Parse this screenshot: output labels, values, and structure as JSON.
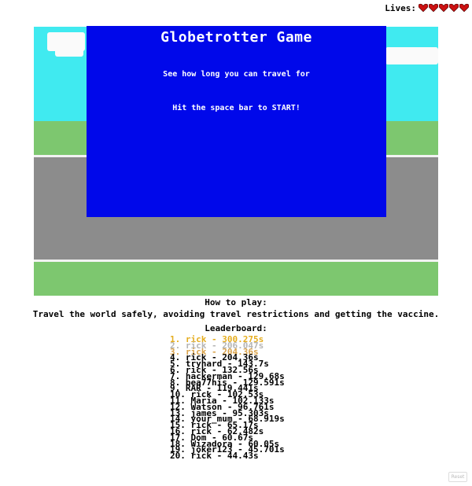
{
  "hud": {
    "lives_label": "Lives:",
    "lives_count": 5
  },
  "menu": {
    "title": "Globetrotter Game",
    "subtitle": "See how long you can travel for",
    "start": "Hit the space bar to START!"
  },
  "howto": {
    "title": "How to play:",
    "text": "Travel the world safely, avoiding travel restrictions and getting the vaccine."
  },
  "leaderboard": {
    "title": "Leaderboard:",
    "entries": [
      "1. rick - 300.275s",
      "2. rick - 206.047s",
      "3. rick - 204.36s",
      "4. rick - 204.36s",
      "5. tryhard - 143.7s",
      "6. rick - 132.56s",
      "7. hackerman - 129.68s",
      "8. bea77his - 129.591s",
      "9. RAR - 119.441s",
      "10. rick - 102.53s",
      "11. Maria - 102.133s",
      "12. Watson - 96.761s",
      "13. james - 95.303s",
      "14. your_mum - 68.919s",
      "15. rick - 65.17s",
      "16. rick - 62.482s",
      "17. Dom - 60.67s",
      "18. Wizadora - 60.05s",
      "19. joker123 - 45.701s",
      "20. rick - 44.43s"
    ]
  },
  "reset_label": "Reset",
  "colors": {
    "gold": "#e5ad1f",
    "silver": "#b5b5b5",
    "bronze": "#d9a24a",
    "menu_bg": "#0008ea",
    "heart": "#cc1111"
  }
}
